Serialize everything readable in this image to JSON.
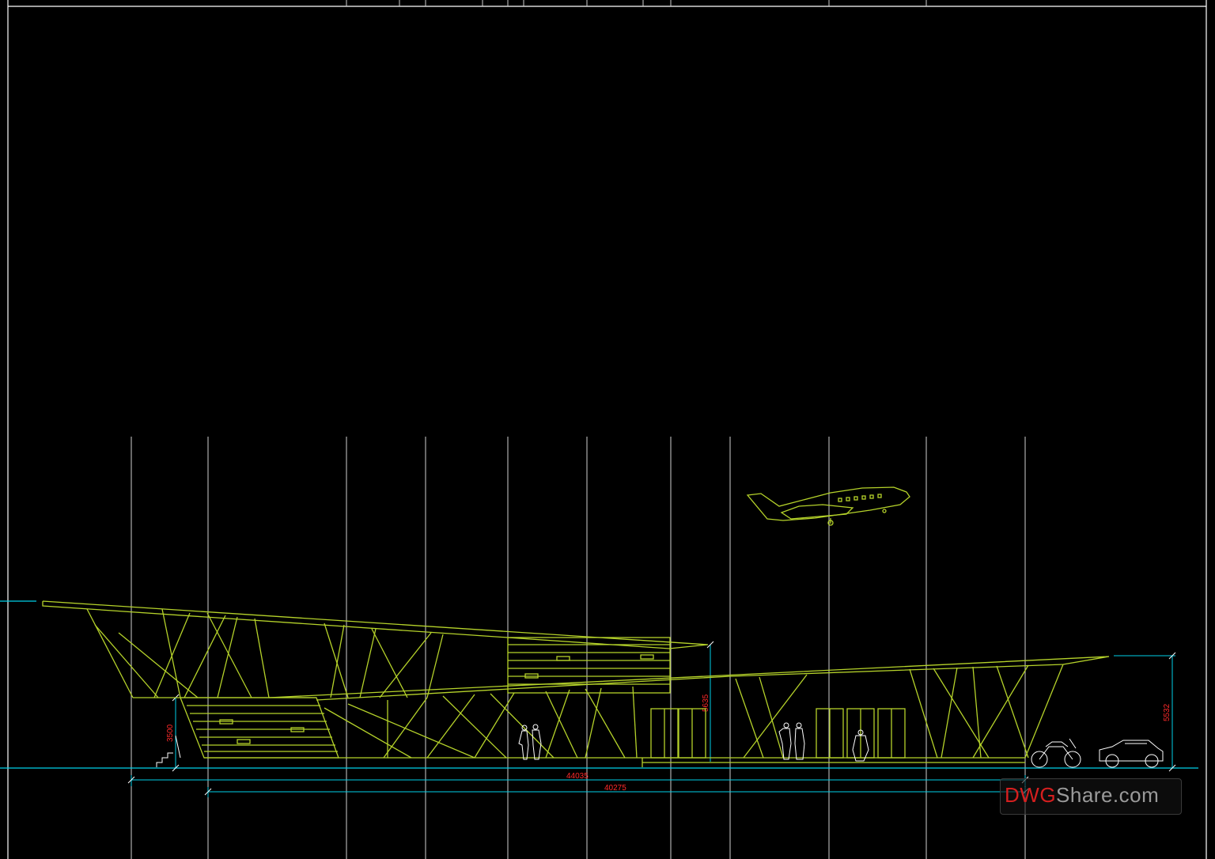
{
  "drawing": {
    "view": "elevation",
    "dimensions": {
      "overall_length": "44035",
      "inner_length": "40275",
      "left_height": "3500",
      "middle_height": "5635",
      "right_height": "5532"
    }
  },
  "watermark": {
    "part1": "DWG",
    "part2": "Share.com"
  },
  "colors": {
    "background": "#000000",
    "grid": "#cfcfcf",
    "structure": "#b5d22a",
    "dimension_line": "#00cfe8",
    "dimension_text": "#ff2a2a",
    "entourage": "#ffffff"
  },
  "icons": [
    "airplane-icon",
    "motorcycle-icon",
    "car-icon",
    "person-icon",
    "stairs-icon"
  ]
}
